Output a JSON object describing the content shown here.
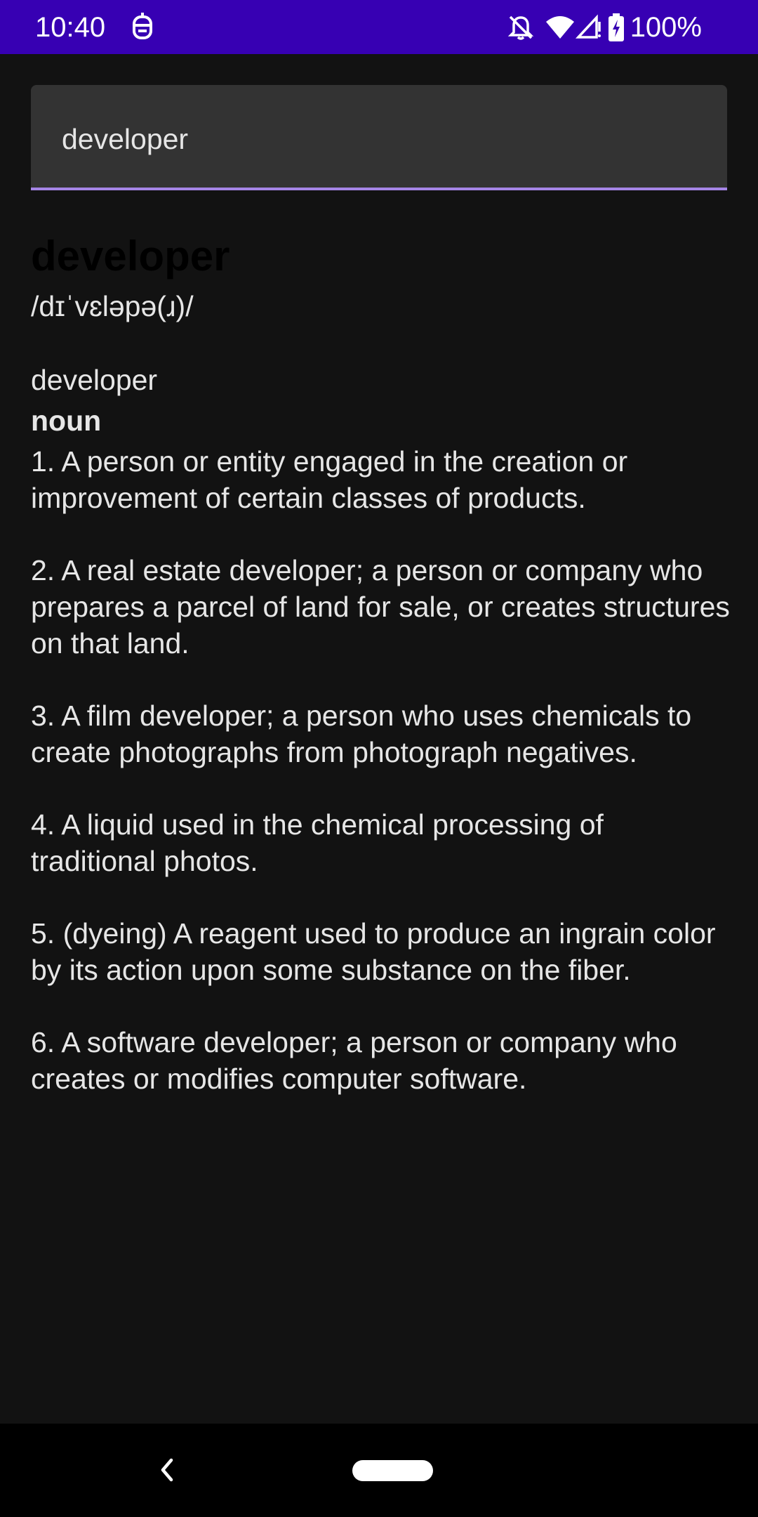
{
  "status_bar": {
    "time": "10:40",
    "left_icon": "assistant-icon",
    "right_icons": [
      "notifications-off-icon",
      "wifi-icon",
      "signal-icon",
      "battery-charging-icon"
    ],
    "battery": "100%",
    "color": "#3700B3"
  },
  "search": {
    "value": "developer",
    "accent_color": "#A585E6"
  },
  "entry": {
    "headword": "developer",
    "phonetic": "/dɪˈvɛləpə(ɹ)/",
    "word": "developer",
    "part_of_speech": "noun",
    "definitions": [
      "1. A person or entity engaged in the creation or improvement of certain classes of products.",
      "2. A real estate developer; a person or company who prepares a parcel of land for sale, or creates structures on that land.",
      "3. A film developer; a person who uses chemicals to create photographs from photograph negatives.",
      "4. A liquid used in the chemical processing of traditional photos.",
      "5. (dyeing) A reagent used to produce an ingrain color by its action upon some substance on the fiber.",
      "6. A software developer; a person or company who creates or modifies computer software."
    ]
  },
  "nav": {
    "back_icon": "back-chevron-icon",
    "home_icon": "home-pill-icon"
  }
}
